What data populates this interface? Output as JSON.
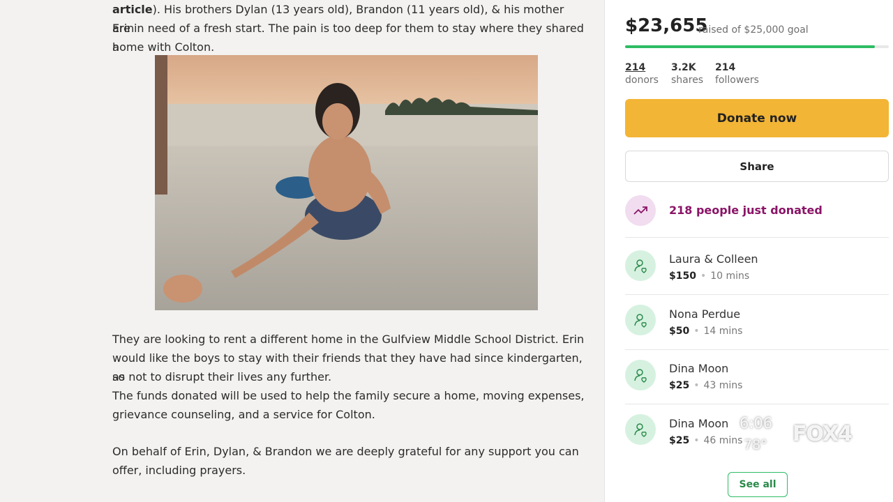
{
  "story": {
    "p1_bold": "article",
    "p1_rest": "). His brothers Dylan (13 years old), Brandon (11 years old), & his mother Erin",
    "p1_line2": "are in need of a fresh start. The pain is too deep for them to stay where they shared a",
    "p1_line3": "home with Colton.",
    "p2_line1": "They are looking to rent a different home in the Gulfview Middle School District. Erin",
    "p2_line2": "would like the boys to stay with their friends that they have had since kindergarten, so",
    "p2_line3": "as not to disrupt their lives any further.",
    "p2_line4": "The funds donated will be used to help the family secure a home, moving expenses,",
    "p2_line5": "grievance counseling, and a service for Colton.",
    "p3_line1": "On behalf of Erin, Dylan, & Brandon we are deeply grateful for any support you can",
    "p3_line2": "offer, including prayers."
  },
  "campaign": {
    "raised": "$23,655",
    "goal_text": "raised of $25,000 goal",
    "progress_fraction": 0.946,
    "stats": [
      {
        "num": "214",
        "label": "donors"
      },
      {
        "num": "3.2K",
        "label": "shares"
      },
      {
        "num": "214",
        "label": "followers"
      }
    ],
    "donate_label": "Donate now",
    "share_label": "Share",
    "trend_text": "218 people just donated",
    "donations": [
      {
        "name": "Laura & Colleen",
        "amount": "$150",
        "time": "10 mins"
      },
      {
        "name": "Nona Perdue",
        "amount": "$50",
        "time": "14 mins"
      },
      {
        "name": "Dina Moon",
        "amount": "$25",
        "time": "43 mins"
      },
      {
        "name": "Dina Moon",
        "amount": "$25",
        "time": "46 mins"
      }
    ],
    "see_all_label": "See all"
  },
  "overlay": {
    "time": "6:06",
    "temp": "78°",
    "logo": "FOX4"
  },
  "colors": {
    "accent_green": "#2ebc63",
    "donate_yellow": "#f3b535",
    "trend_purple": "#8a1467"
  }
}
